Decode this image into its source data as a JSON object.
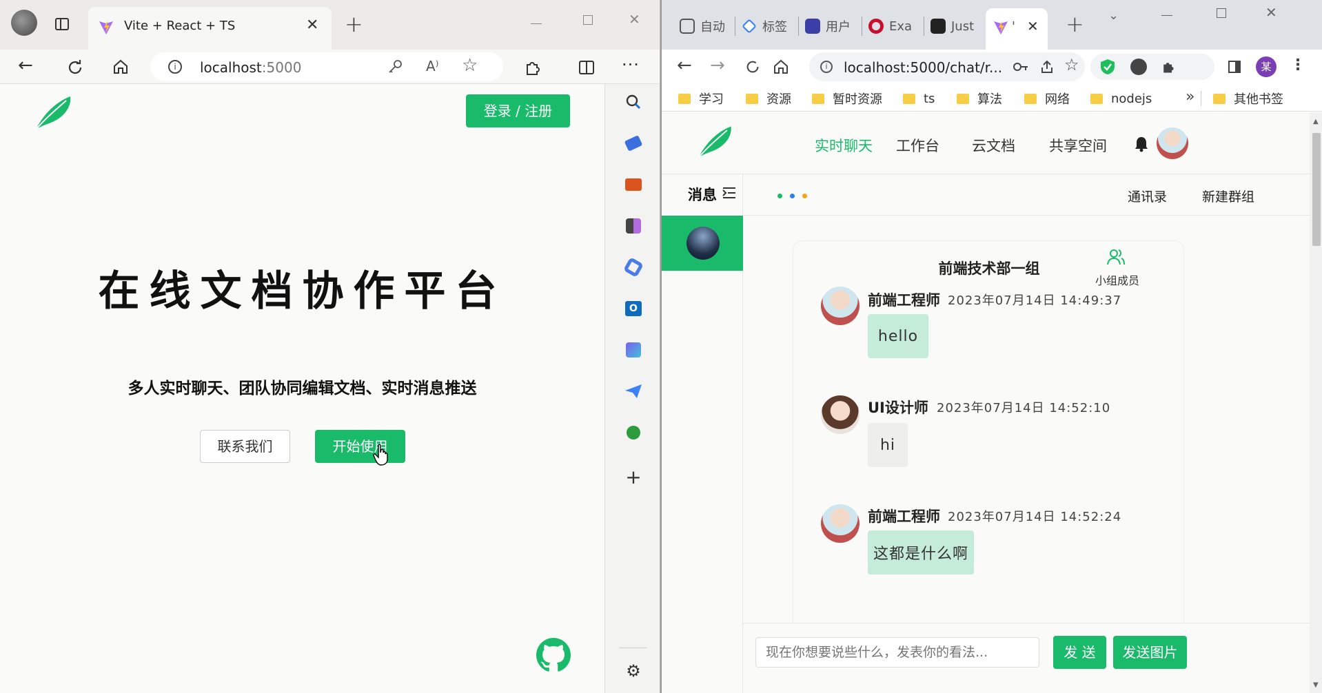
{
  "left_window": {
    "tab_title": "Vite + React + TS",
    "url_host": "localhost",
    "url_port": ":5000",
    "page": {
      "login_button": "登录 / 注册",
      "hero_title": "在线文档协作平台",
      "hero_subtitle": "多人实时聊天、团队协同编辑文档、实时消息推送",
      "contact_button": "联系我们",
      "start_button": "开始使用"
    },
    "brand_color": "#19bb6b"
  },
  "right_window": {
    "tabs": [
      {
        "label": "自动",
        "icon": "chatgpt-icon"
      },
      {
        "label": "标签",
        "icon": "diamond-icon"
      },
      {
        "label": "用户",
        "icon": "chart-icon"
      },
      {
        "label": "Exa",
        "icon": "opera-icon"
      },
      {
        "label": "Just",
        "icon": "notion-icon"
      },
      {
        "label": "'",
        "icon": "vite-icon"
      }
    ],
    "url": "localhost:5000/chat/r...",
    "bookmarks": [
      "学习",
      "资源",
      "暂时资源",
      "ts",
      "算法",
      "网络",
      "nodejs"
    ],
    "bookmarks_overflow": "»",
    "other_bookmarks": "其他书签",
    "profile_initial": "某",
    "app": {
      "nav": [
        "实时聊天",
        "工作台",
        "云文档",
        "共享空间"
      ],
      "active_nav": "实时聊天",
      "sidebar_header": "消息",
      "contacts_link": "通讯录",
      "new_group_link": "新建群组",
      "group_name": "前端技术部一组",
      "members_label": "小组成员",
      "messages": [
        {
          "user": "前端工程师",
          "time": "2023年07月14日 14:49:37",
          "text": "hello",
          "mine": true
        },
        {
          "user": "UI设计师",
          "time": "2023年07月14日 14:52:10",
          "text": "hi",
          "mine": false
        },
        {
          "user": "前端工程师",
          "time": "2023年07月14日 14:52:24",
          "text": "这都是什么啊",
          "mine": true
        }
      ],
      "input_placeholder": "现在你想要说些什么，发表你的看法...",
      "send_button": "发 送",
      "send_image_button": "发送图片"
    }
  }
}
